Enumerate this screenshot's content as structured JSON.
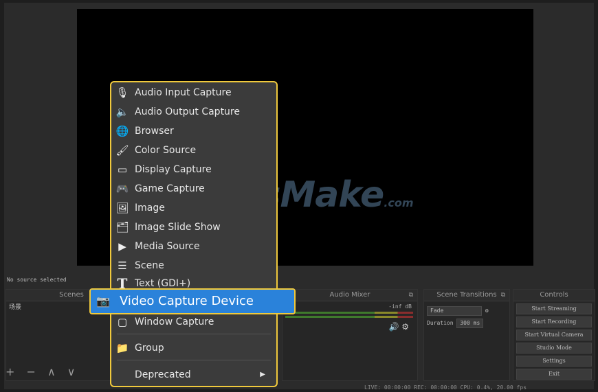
{
  "status_left": "No source selected",
  "watermark": {
    "main": "TipsMake",
    "suffix": ".com"
  },
  "menu": {
    "items": [
      {
        "icon": "microphone-icon",
        "glyph": "🎙",
        "label": "Audio Input Capture"
      },
      {
        "icon": "speaker-icon",
        "glyph": "🔈",
        "label": "Audio Output Capture"
      },
      {
        "icon": "globe-icon",
        "glyph": "🌐",
        "label": "Browser"
      },
      {
        "icon": "brush-icon",
        "glyph": "🖌",
        "label": "Color Source"
      },
      {
        "icon": "monitor-icon",
        "glyph": "▭",
        "label": "Display Capture"
      },
      {
        "icon": "gamepad-icon",
        "glyph": "🎮",
        "label": "Game Capture"
      },
      {
        "icon": "image-icon",
        "glyph": "🖼",
        "label": "Image"
      },
      {
        "icon": "slideshow-icon",
        "glyph": "🗂",
        "label": "Image Slide Show"
      },
      {
        "icon": "play-icon",
        "glyph": "▶",
        "label": "Media Source"
      },
      {
        "icon": "list-icon",
        "glyph": "☰",
        "label": "Scene"
      },
      {
        "icon": "text-icon",
        "glyph": "T",
        "label": "Text (GDI+)"
      }
    ],
    "highlighted": {
      "icon": "camera-icon",
      "glyph": "📷",
      "label": "Video Capture Device"
    },
    "window_capture": {
      "icon": "window-icon",
      "glyph": "▢",
      "label": "Window Capture"
    },
    "group": {
      "icon": "folder-icon",
      "glyph": "📁",
      "label": "Group"
    },
    "deprecated": {
      "label": "Deprecated",
      "arrow": "▶"
    }
  },
  "docks": {
    "scenes": {
      "title": "Scenes",
      "items": [
        "场景"
      ],
      "footer": "+ − ∧ ∨"
    },
    "mixer": {
      "title": "Audio Mixer",
      "db": "-inf dB"
    },
    "transitions": {
      "title": "Scene Transitions",
      "type": "Fade",
      "duration_label": "Duration",
      "duration_value": "300 ms"
    },
    "controls": {
      "title": "Controls",
      "buttons": [
        "Start Streaming",
        "Start Recording",
        "Start Virtual Camera",
        "Studio Mode",
        "Settings",
        "Exit"
      ]
    }
  },
  "statusbar": "LIVE: 00:00:00   REC: 00:00:00   CPU: 0.4%, 20.00 fps"
}
